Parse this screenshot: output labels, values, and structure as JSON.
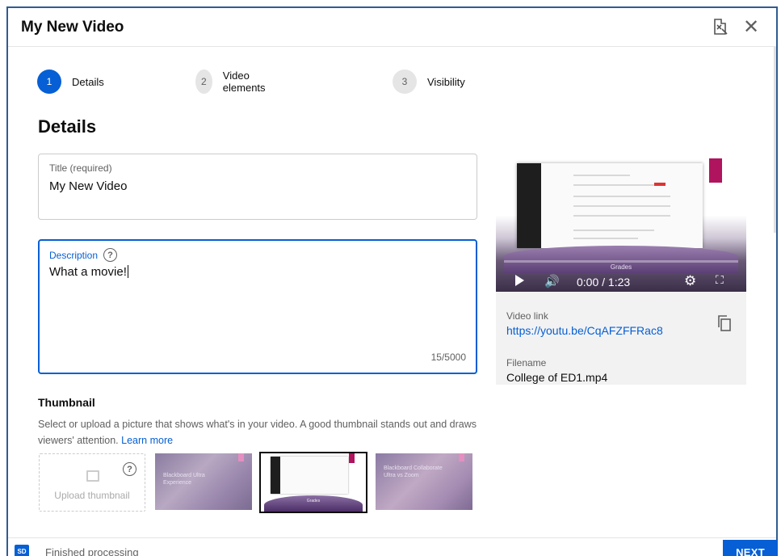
{
  "dialog": {
    "title": "My New Video",
    "close_glyph": "✕"
  },
  "stepper": {
    "steps": [
      {
        "number": "1",
        "label": "Details",
        "active": true
      },
      {
        "number": "2",
        "label": "Video elements",
        "active": false
      },
      {
        "number": "3",
        "label": "Visibility",
        "active": false
      }
    ]
  },
  "details": {
    "heading": "Details",
    "title_field": {
      "label": "Title (required)",
      "value": "My New Video"
    },
    "description_field": {
      "label": "Description",
      "value": "What a movie!",
      "counter": "15/5000"
    }
  },
  "thumbnail": {
    "heading": "Thumbnail",
    "description": "Select or upload a picture that shows what's in your video. A good thumbnail stands out and draws viewers' attention.",
    "learn_more": "Learn more",
    "upload_label": "Upload thumbnail",
    "options": [
      {
        "text": "Blackboard Ultra Experience"
      },
      {
        "text": "Grades"
      },
      {
        "text": "Blackboard Collaborate Ultra vs Zoom"
      }
    ],
    "selected_index": 1
  },
  "preview": {
    "overlay_text": "Grades",
    "time": "0:00 / 1:23",
    "video_link_label": "Video link",
    "video_link": "https://youtu.be/CqAFZFFRac8",
    "filename_label": "Filename",
    "filename": "College of ED1.mp4"
  },
  "footer": {
    "badge": "SD",
    "status": "Finished processing",
    "next_label": "NEXT"
  },
  "colors": {
    "accent": "#065fd4",
    "frame_border": "#2f5c8f",
    "thumbnail_marker": "#b0145f"
  },
  "icons": [
    "feedback-icon",
    "close-icon",
    "help-icon",
    "add-photo-icon",
    "play-icon",
    "volume-icon",
    "settings-gear-icon",
    "fullscreen-icon",
    "copy-icon"
  ]
}
